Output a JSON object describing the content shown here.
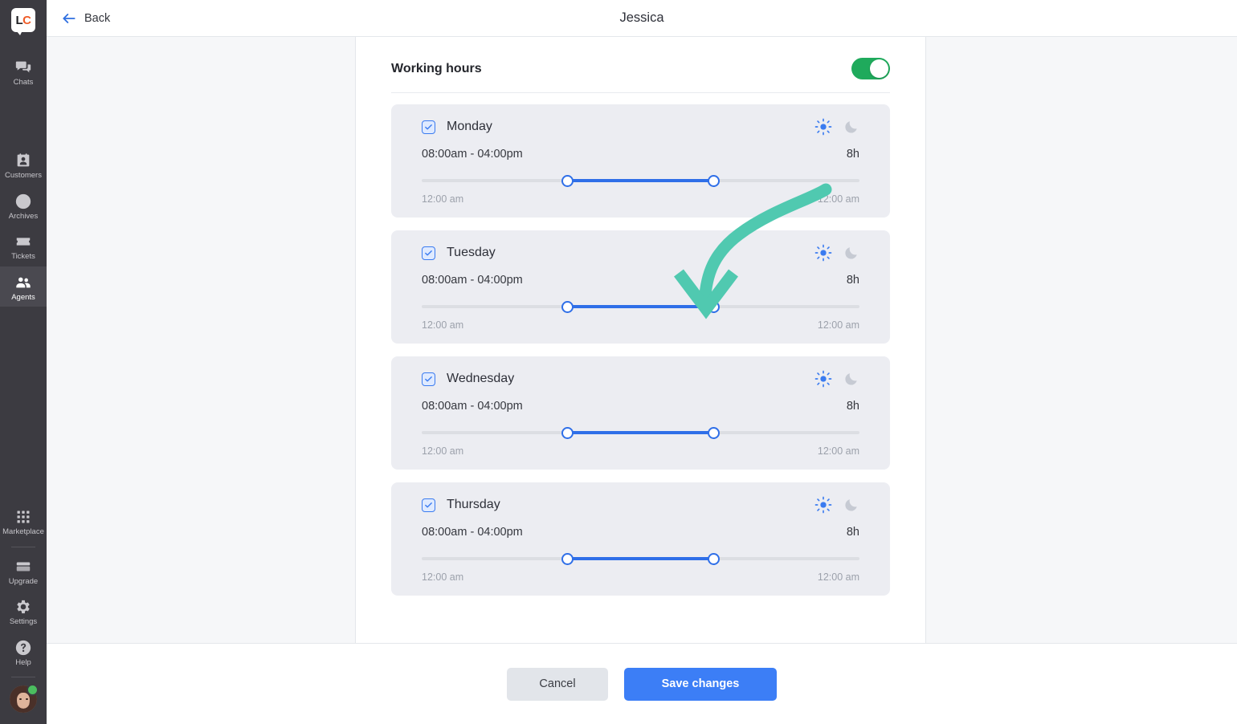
{
  "rail": {
    "logo": {
      "left": "L",
      "right": "C",
      "name": "livechat-logo"
    },
    "items": [
      {
        "label": "Chats",
        "icon": "chats-icon",
        "active": false
      },
      {
        "label": "Customers",
        "icon": "customers-icon",
        "active": false
      },
      {
        "label": "Archives",
        "icon": "archives-icon",
        "active": false
      },
      {
        "label": "Tickets",
        "icon": "tickets-icon",
        "active": false
      },
      {
        "label": "Agents",
        "icon": "agents-icon",
        "active": true
      }
    ],
    "bottom_items": [
      {
        "label": "Marketplace",
        "icon": "marketplace-icon"
      },
      {
        "label": "Upgrade",
        "icon": "upgrade-icon"
      },
      {
        "label": "Settings",
        "icon": "gear-icon"
      },
      {
        "label": "Help",
        "icon": "help-icon"
      }
    ],
    "avatar": {
      "name": "user-avatar",
      "status": "online",
      "status_color": "#4bbd5f"
    }
  },
  "topbar": {
    "back_label": "Back",
    "title": "Jessica"
  },
  "section": {
    "title": "Working hours",
    "enabled": true,
    "toggle_color": "#1faa5c"
  },
  "days": [
    {
      "name": "Monday",
      "checked": true,
      "mode": "day",
      "range": "08:00am - 04:00pm",
      "duration": "8h",
      "start_label": "12:00 am",
      "end_label": "12:00 am",
      "start_pct": 33.3,
      "end_pct": 66.6
    },
    {
      "name": "Tuesday",
      "checked": true,
      "mode": "day",
      "range": "08:00am - 04:00pm",
      "duration": "8h",
      "start_label": "12:00 am",
      "end_label": "12:00 am",
      "start_pct": 33.3,
      "end_pct": 66.6
    },
    {
      "name": "Wednesday",
      "checked": true,
      "mode": "day",
      "range": "08:00am - 04:00pm",
      "duration": "8h",
      "start_label": "12:00 am",
      "end_label": "12:00 am",
      "start_pct": 33.3,
      "end_pct": 66.6
    },
    {
      "name": "Thursday",
      "checked": true,
      "mode": "day",
      "range": "08:00am - 04:00pm",
      "duration": "8h",
      "start_label": "12:00 am",
      "end_label": "12:00 am",
      "start_pct": 33.3,
      "end_pct": 66.6
    }
  ],
  "footer": {
    "cancel_label": "Cancel",
    "save_label": "Save changes",
    "save_color": "#3c7ef6",
    "cancel_color": "#e2e5ea"
  },
  "annotation": {
    "type": "curved-arrow",
    "color": "#50c9b0",
    "points_to": "tuesday-slider-end-handle"
  }
}
